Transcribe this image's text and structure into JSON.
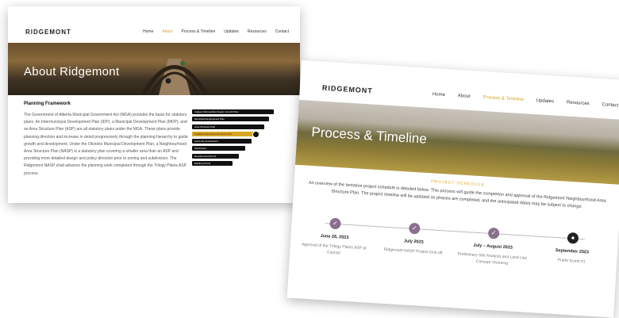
{
  "colors": {
    "accent": "#d9a520",
    "timeline_dot": "#8a6f8f",
    "dark": "#111111"
  },
  "page1": {
    "logo": "RIDGEMONT",
    "nav": [
      "Home",
      "About",
      "Process & Timeline",
      "Updates",
      "Resources",
      "Contact"
    ],
    "active_nav": "About",
    "hero_title": "About Ridgemont",
    "heading": "Planning Framework",
    "paragraph": "The Government of Alberta Municipal Government Act (MGA) provides the basis for statutory plans. An Intermunicipal Development Plan (IDP), a Municipal Development Plan (MDP), and an Area Structure Plan (ASP) are all statutory plans under the MGA. These plans provide planning direction and increase in detail progressively through the planning hierarchy to guide growth and development. Under the Okotoks Municipal Development Plan, a Neighbourhood Area Structure Plan (NASP) is a statutory plan covering a smaller area than an ASP and providing more detailed design and policy direction prior to zoning and subdivision. The Ridgemont NASP shall advance the planning work completed through the Trilogy Plains ASP process.",
    "flow_steps": [
      "Calgary Metropolitan Region Growth Plan",
      "Municipal Development Plan",
      "Area Structure Plan",
      "Neighbourhood Area Structure Plan",
      "Land Use Amendment",
      "Subdivision",
      "Development Permit",
      "Building Permit"
    ],
    "flow_highlight_index": 3
  },
  "page2": {
    "logo": "RIDGEMONT",
    "nav": [
      "Home",
      "About",
      "Process & Timeline",
      "Updates",
      "Resources",
      "Contact"
    ],
    "active_nav": "Process & Timeline",
    "hero_title": "Process & Timeline",
    "section_label": "PROJECT SCHEDULE",
    "intro": "An overview of the tentative project schedule is detailed below. This process will guide the completion and approval of the Ridgemont Neighbourhood Area Structure Plan. The project timeline will be updated as phases are completed, and the anticipated dates may be subject to change.",
    "timeline": [
      {
        "date": "June 26, 2023",
        "desc": "Approval of the Trilogy Plains ASP at Council",
        "icon": "check-icon"
      },
      {
        "date": "July 2023",
        "desc": "Ridgemont NASP Project Kick-off",
        "icon": "check-icon"
      },
      {
        "date": "July – August 2023",
        "desc": "Preliminary Site Analysis and Land Use Concept Visioning",
        "icon": "check-icon"
      },
      {
        "date": "September 2023",
        "desc": "Public Event #1",
        "icon": "location-pin-icon"
      }
    ]
  }
}
